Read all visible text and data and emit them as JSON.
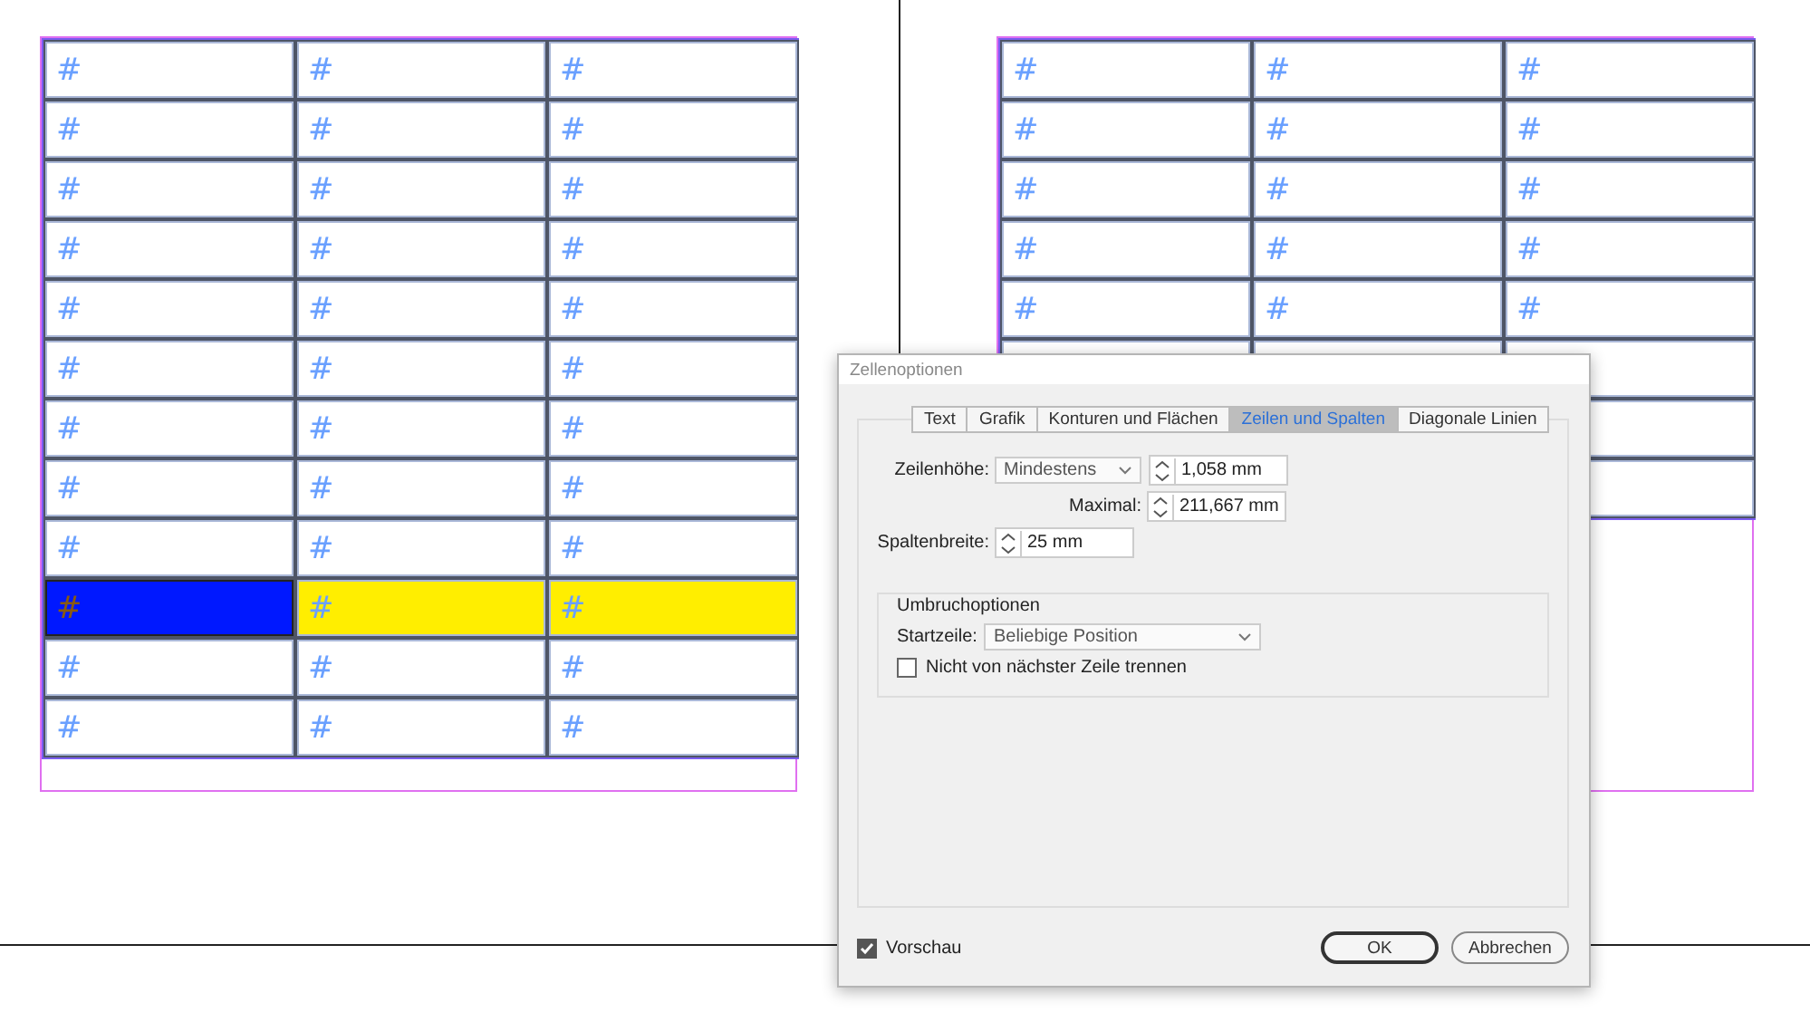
{
  "tables": [
    {
      "rows": [
        {
          "cells": [
            {
              "text": "#"
            },
            {
              "text": "#"
            },
            {
              "text": "#"
            }
          ]
        },
        {
          "cells": [
            {
              "text": "#"
            },
            {
              "text": "#"
            },
            {
              "text": "#"
            }
          ]
        },
        {
          "cells": [
            {
              "text": "#"
            },
            {
              "text": "#"
            },
            {
              "text": "#"
            }
          ]
        },
        {
          "cells": [
            {
              "text": "#"
            },
            {
              "text": "#"
            },
            {
              "text": "#"
            }
          ]
        },
        {
          "cells": [
            {
              "text": "#"
            },
            {
              "text": "#"
            },
            {
              "text": "#"
            }
          ]
        },
        {
          "cells": [
            {
              "text": "#"
            },
            {
              "text": "#"
            },
            {
              "text": "#"
            }
          ]
        },
        {
          "cells": [
            {
              "text": "#"
            },
            {
              "text": "#"
            },
            {
              "text": "#"
            }
          ]
        },
        {
          "cells": [
            {
              "text": "#"
            },
            {
              "text": "#"
            },
            {
              "text": "#"
            }
          ]
        },
        {
          "cells": [
            {
              "text": "#"
            },
            {
              "text": "#"
            },
            {
              "text": "#"
            }
          ]
        },
        {
          "cells": [
            {
              "text": "#",
              "color": "#0018ff",
              "selected": true
            },
            {
              "text": "#",
              "color": "#ffee00",
              "selected": false
            },
            {
              "text": "#",
              "color": "#ffee00",
              "selected": false
            }
          ]
        },
        {
          "cells": [
            {
              "text": "#"
            },
            {
              "text": "#"
            },
            {
              "text": "#"
            }
          ]
        },
        {
          "cells": [
            {
              "text": "#"
            },
            {
              "text": "#"
            },
            {
              "text": "#"
            }
          ]
        }
      ]
    },
    {
      "rows": [
        {
          "cells": [
            {
              "text": "#"
            },
            {
              "text": "#"
            },
            {
              "text": "#"
            }
          ]
        },
        {
          "cells": [
            {
              "text": "#"
            },
            {
              "text": "#"
            },
            {
              "text": "#"
            }
          ]
        },
        {
          "cells": [
            {
              "text": "#"
            },
            {
              "text": "#"
            },
            {
              "text": "#"
            }
          ]
        },
        {
          "cells": [
            {
              "text": "#"
            },
            {
              "text": "#"
            },
            {
              "text": "#"
            }
          ]
        },
        {
          "cells": [
            {
              "text": "#"
            },
            {
              "text": "#"
            },
            {
              "text": "#"
            }
          ]
        },
        {
          "cells": [
            {},
            {},
            {}
          ]
        },
        {
          "cells": [
            null,
            null,
            {}
          ]
        },
        {
          "cells": [
            null,
            null,
            {}
          ]
        }
      ]
    }
  ],
  "dialog": {
    "title": "Zellenoptionen",
    "tabs": [
      {
        "label": "Text",
        "selected": false
      },
      {
        "label": "Grafik",
        "selected": false
      },
      {
        "label": "Konturen und Flächen",
        "selected": false
      },
      {
        "label": "Zeilen und Spalten",
        "selected": true
      },
      {
        "label": "Diagonale Linien",
        "selected": false
      }
    ],
    "row_height": {
      "label": "Zeilenhöhe:",
      "mode": "Mindestens",
      "value": "1,058 mm"
    },
    "maximum": {
      "label": "Maximal:",
      "value": "211,667 mm"
    },
    "column_width": {
      "label": "Spaltenbreite:",
      "value": "25 mm"
    },
    "break_options": {
      "title": "Umbruchoptionen",
      "start_row": {
        "label": "Startzeile:",
        "value": "Beliebige Position"
      },
      "keep_with_next": {
        "label": "Nicht von nächster Zeile trennen",
        "checked": false
      }
    },
    "preview": {
      "label": "Vorschau",
      "checked": true
    },
    "buttons": [
      "OK",
      "Abbrechen"
    ]
  }
}
